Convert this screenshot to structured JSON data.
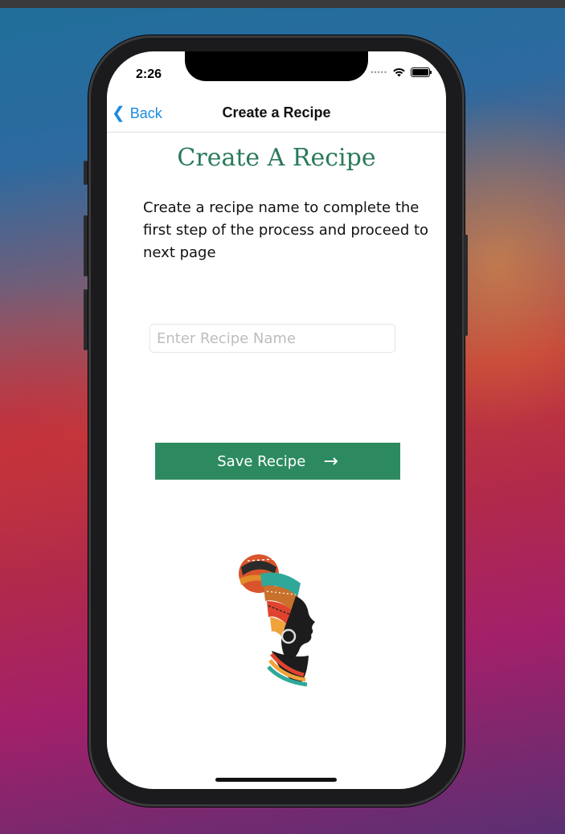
{
  "status_bar": {
    "time": "2:26"
  },
  "nav": {
    "back_label": "Back",
    "title": "Create a Recipe"
  },
  "main": {
    "heading": "Create A Recipe",
    "description": "Create a recipe name to complete the first step of the process and proceed to next page",
    "recipe_input": {
      "placeholder": "Enter Recipe Name",
      "value": ""
    },
    "save_button": {
      "label": "Save Recipe",
      "icon": "arrow-right-icon"
    }
  },
  "colors": {
    "accent_green": "#2d8a60",
    "link_blue": "#1a8be0"
  },
  "icons": [
    "back-chevron-icon",
    "wifi-icon",
    "battery-icon",
    "arrow-right-icon"
  ],
  "illustration": "african-woman-headwrap-illustration"
}
